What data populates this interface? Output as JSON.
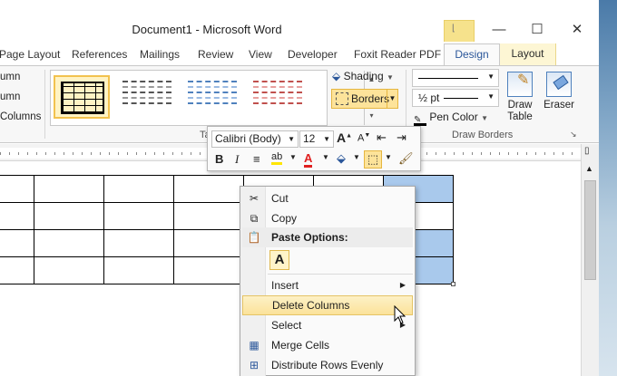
{
  "window": {
    "title": "Document1  -  Microsoft Word",
    "min": "—",
    "max": "☐",
    "close": "✕"
  },
  "tabs": [
    "Page Layout",
    "References",
    "Mailings",
    "Review",
    "View",
    "Developer",
    "Foxit Reader PDF"
  ],
  "context_tabs": {
    "design": "Design",
    "layout": "Layout"
  },
  "ribbon": {
    "left_items": [
      "umn",
      "umn",
      "Columns"
    ],
    "shading": "Shading",
    "borders": "Borders",
    "pen_weight": "½ pt",
    "pen_color": "Pen Color",
    "draw_table": "Draw Table",
    "eraser": "Eraser",
    "group_table_styles": "Ta",
    "group_draw_borders": "Draw Borders"
  },
  "mini_toolbar": {
    "font": "Calibri (Body)",
    "size": "12",
    "bold": "B",
    "italic": "I"
  },
  "context_menu": {
    "cut": "Cut",
    "copy": "Copy",
    "paste_options": "Paste Options:",
    "paste_A": "A",
    "insert": "Insert",
    "delete_columns": "Delete Columns",
    "select": "Select",
    "merge_cells": "Merge Cells",
    "distribute_rows": "Distribute Rows Evenly"
  },
  "colors": {
    "accent": "#2b579a",
    "highlight": "#fbe29a",
    "selection": "#a9c9ec"
  }
}
